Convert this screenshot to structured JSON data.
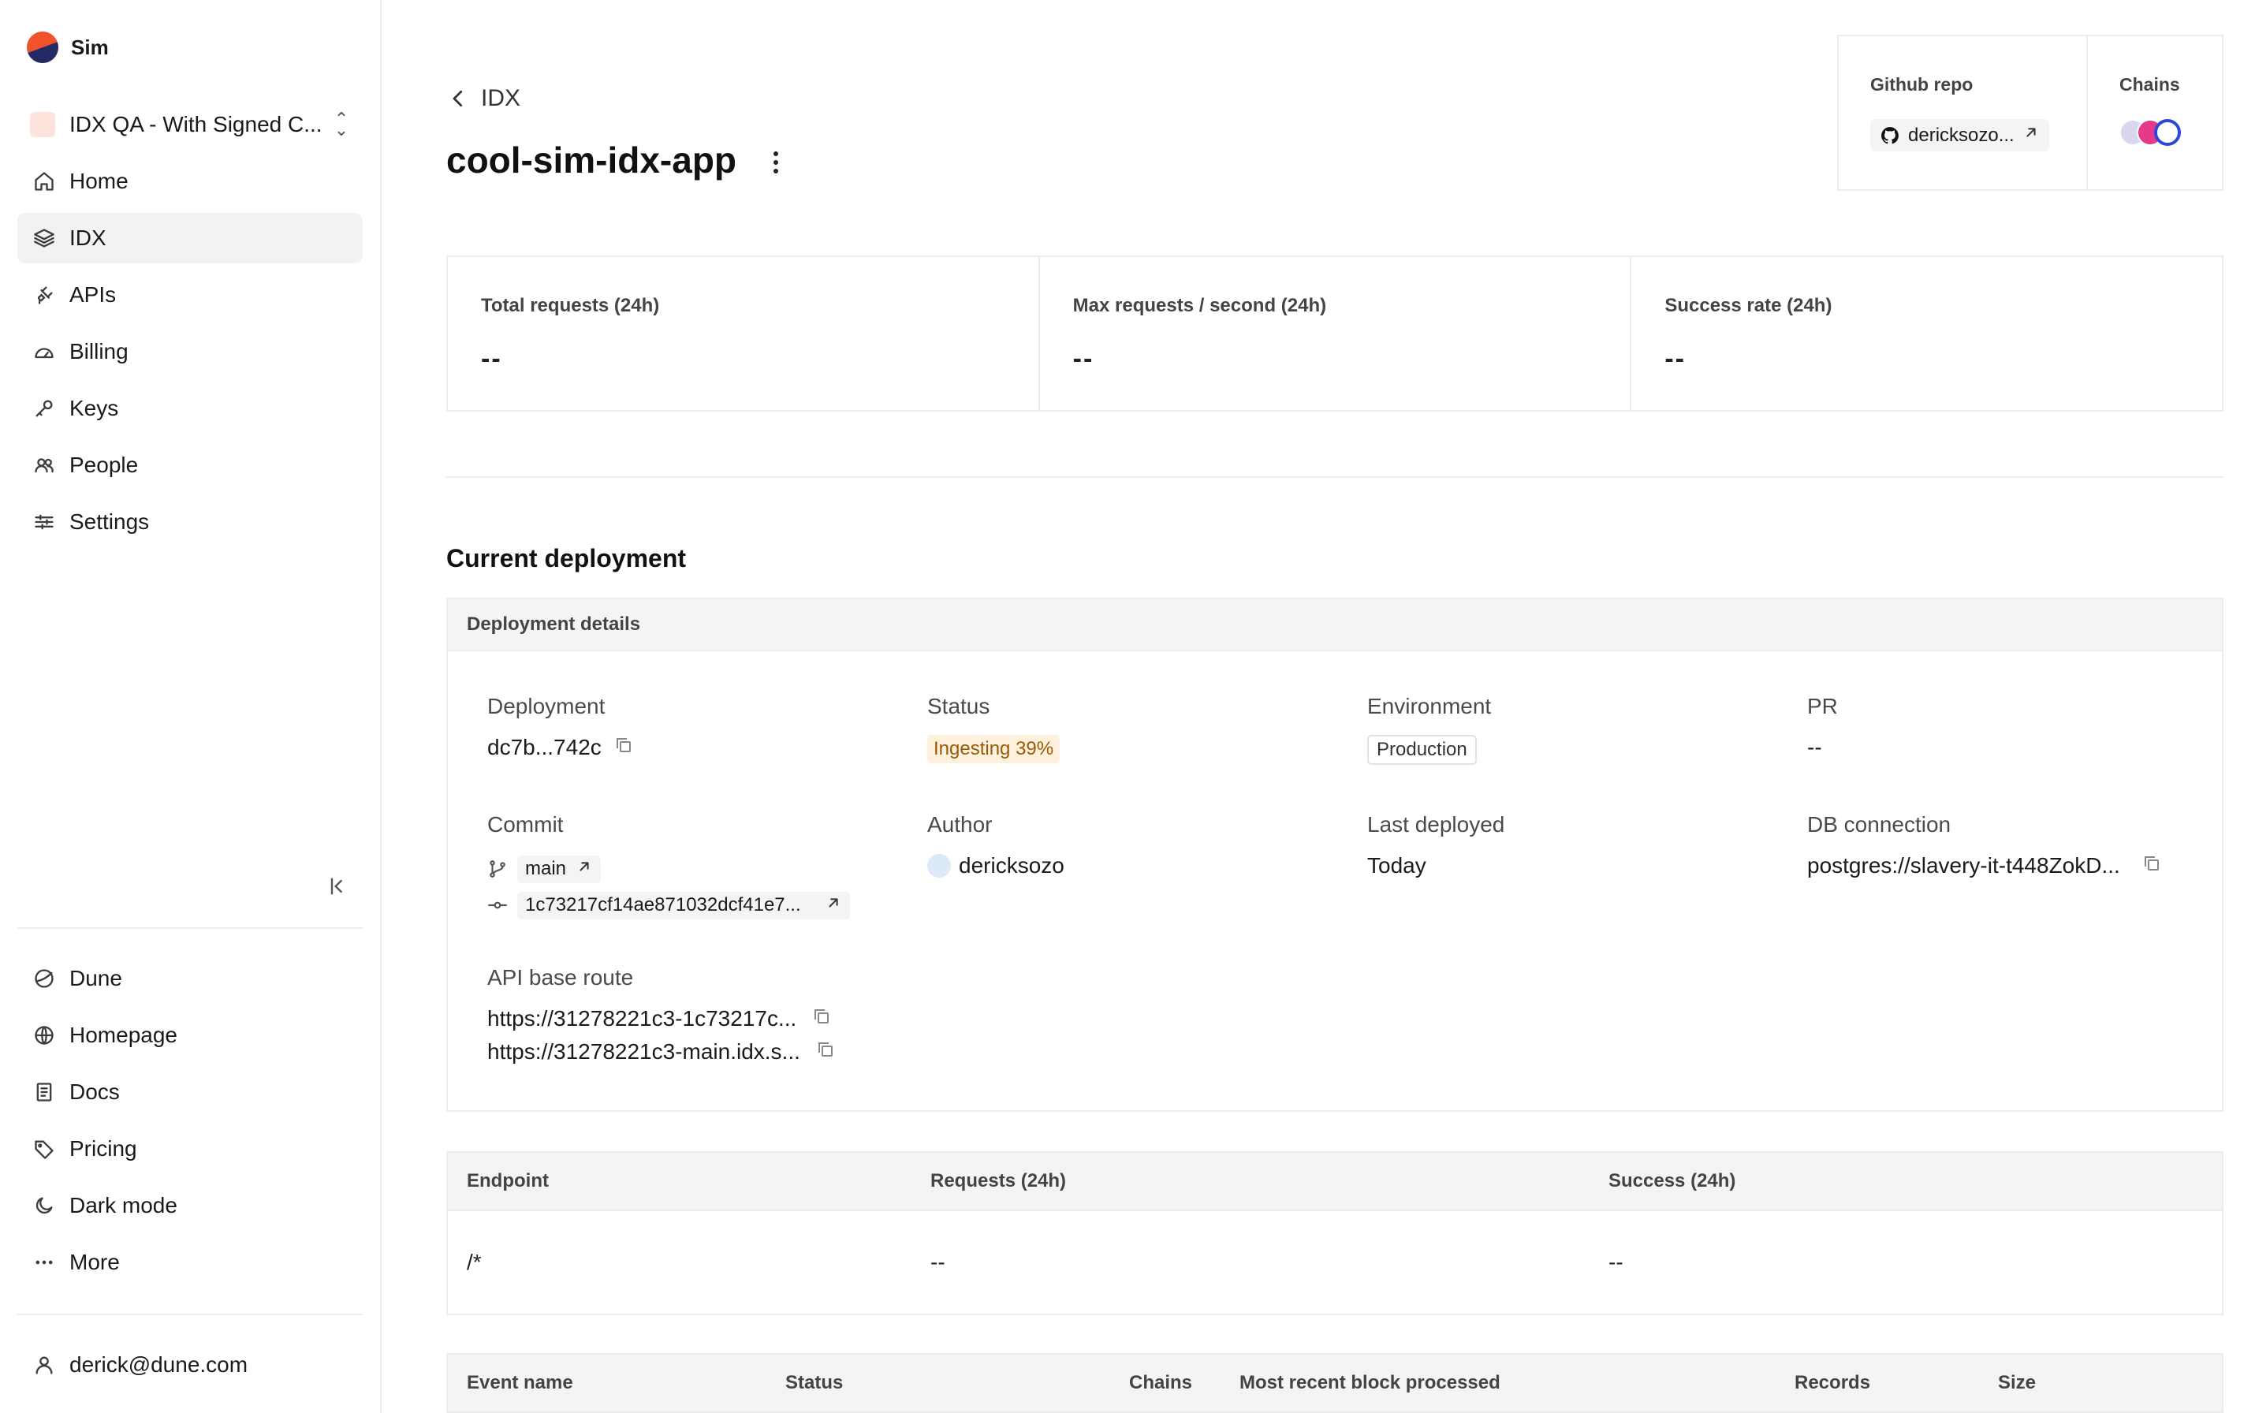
{
  "brand": {
    "name": "Sim"
  },
  "team": {
    "name": "IDX QA - With Signed C..."
  },
  "nav": {
    "primary": [
      {
        "label": "Home",
        "icon": "home-icon"
      },
      {
        "label": "IDX",
        "icon": "layers-icon",
        "active": true
      },
      {
        "label": "APIs",
        "icon": "plug-icon"
      },
      {
        "label": "Billing",
        "icon": "gauge-icon"
      },
      {
        "label": "Keys",
        "icon": "key-icon"
      },
      {
        "label": "People",
        "icon": "users-icon"
      },
      {
        "label": "Settings",
        "icon": "sliders-icon"
      }
    ],
    "secondary": [
      {
        "label": "Dune",
        "icon": "dune-icon"
      },
      {
        "label": "Homepage",
        "icon": "globe-icon"
      },
      {
        "label": "Docs",
        "icon": "document-icon"
      },
      {
        "label": "Pricing",
        "icon": "tag-icon"
      },
      {
        "label": "Dark mode",
        "icon": "moon-icon"
      },
      {
        "label": "More",
        "icon": "ellipsis-icon"
      }
    ],
    "user": {
      "label": "derick@dune.com",
      "icon": "user-icon"
    }
  },
  "header": {
    "back_label": "IDX",
    "title": "cool-sim-idx-app"
  },
  "repo": {
    "github_label": "Github repo",
    "github_value": "dericksozo...",
    "chains_label": "Chains",
    "chain_colors": [
      "#d9d6f0",
      "#e8388a",
      "#2a49d8"
    ]
  },
  "stats": [
    {
      "label": "Total requests (24h)",
      "value": "--"
    },
    {
      "label": "Max requests / second (24h)",
      "value": "--"
    },
    {
      "label": "Success rate (24h)",
      "value": "--"
    }
  ],
  "current_deployment": {
    "section_title": "Current deployment",
    "card_title": "Deployment details",
    "deployment": {
      "label": "Deployment",
      "value": "dc7b...742c"
    },
    "status": {
      "label": "Status",
      "value": "Ingesting 39%",
      "progress_percent": 39
    },
    "environment": {
      "label": "Environment",
      "value": "Production"
    },
    "pr": {
      "label": "PR",
      "value": "--"
    },
    "commit": {
      "label": "Commit",
      "branch": "main",
      "sha": "1c73217cf14ae871032dcf41e7..."
    },
    "author": {
      "label": "Author",
      "value": "dericksozo"
    },
    "last_deployed": {
      "label": "Last deployed",
      "value": "Today"
    },
    "db_connection": {
      "label": "DB connection",
      "value": "postgres://slavery-it-t448ZokD..."
    },
    "api_base_route": {
      "label": "API base route",
      "routes": [
        "https://31278221c3-1c73217c...",
        "https://31278221c3-main.idx.s..."
      ]
    }
  },
  "endpoints": {
    "columns": [
      "Endpoint",
      "Requests (24h)",
      "Success (24h)"
    ],
    "rows": [
      {
        "endpoint": "/*",
        "requests": "--",
        "success": "--"
      }
    ]
  },
  "events": {
    "columns": [
      "Event name",
      "Status",
      "Chains",
      "Most recent block processed",
      "Records",
      "Size"
    ]
  }
}
